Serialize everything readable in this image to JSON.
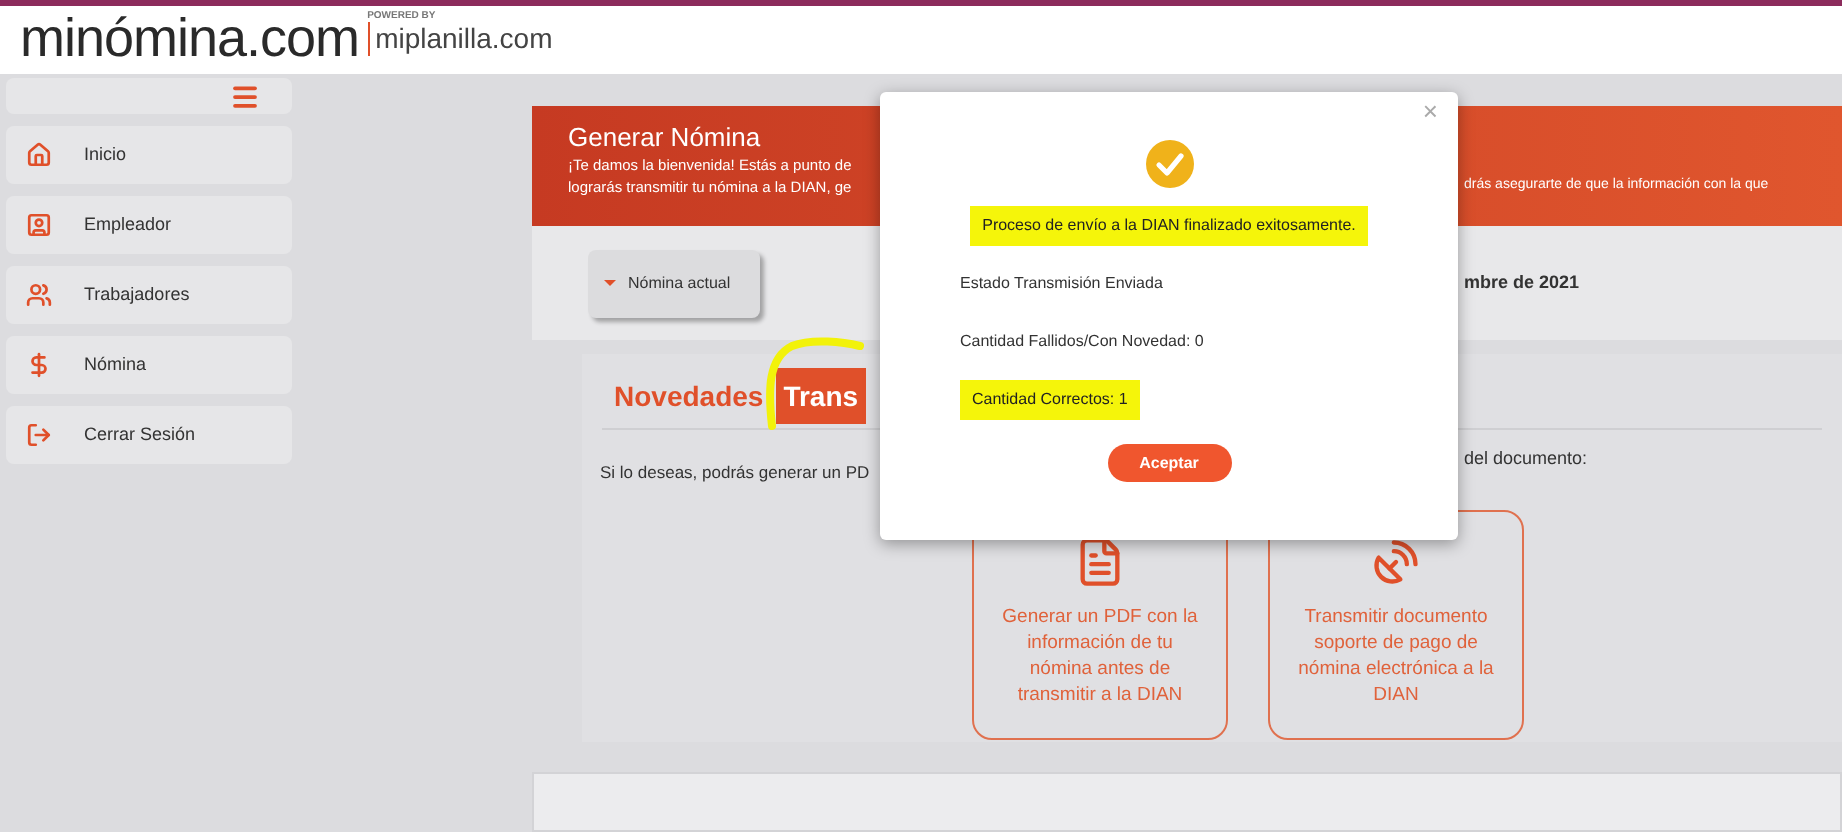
{
  "header": {
    "logo": "minómina.com",
    "powered_by": "POWERED BY",
    "partner": "miplanilla.com"
  },
  "sidebar": {
    "items": [
      {
        "label": "Inicio"
      },
      {
        "label": "Empleador"
      },
      {
        "label": "Trabajadores"
      },
      {
        "label": "Nómina"
      },
      {
        "label": "Cerrar Sesión"
      }
    ]
  },
  "banner": {
    "title": "Generar Nómina",
    "line_1_left": "¡Te damos la bienvenida! Estás a punto de",
    "line_2_left": "lograrás transmitir tu nómina a la DIAN, ge",
    "line_1_right": "drás asegurarte de que la información con la que"
  },
  "period": {
    "button": "Nómina actual",
    "date_fragment": "mbre de 2021"
  },
  "tabs": [
    {
      "label": "Novedades",
      "selected": false
    },
    {
      "label": "Trans",
      "selected": true
    }
  ],
  "intro_left": "Si lo deseas, podrás generar un PD",
  "intro_right": "del documento:",
  "actions": [
    {
      "label": "Generar un PDF con la información de tu nómina antes de transmitir a la DIAN"
    },
    {
      "label": "Transmitir documento soporte de pago de nómina electrónica a la DIAN"
    }
  ],
  "modal": {
    "close": "×",
    "lines": [
      {
        "text": "Proceso de envío a la DIAN finalizado exitosamente.",
        "highlighted": true,
        "centered": true
      },
      {
        "text": "Estado Transmisión Enviada",
        "highlighted": false,
        "centered": false
      },
      {
        "text": "Cantidad Fallidos/Con Novedad: 0",
        "highlighted": false,
        "centered": false
      },
      {
        "text": "Cantidad Correctos: 1",
        "highlighted": true,
        "centered": false
      }
    ],
    "button": "Aceptar"
  }
}
